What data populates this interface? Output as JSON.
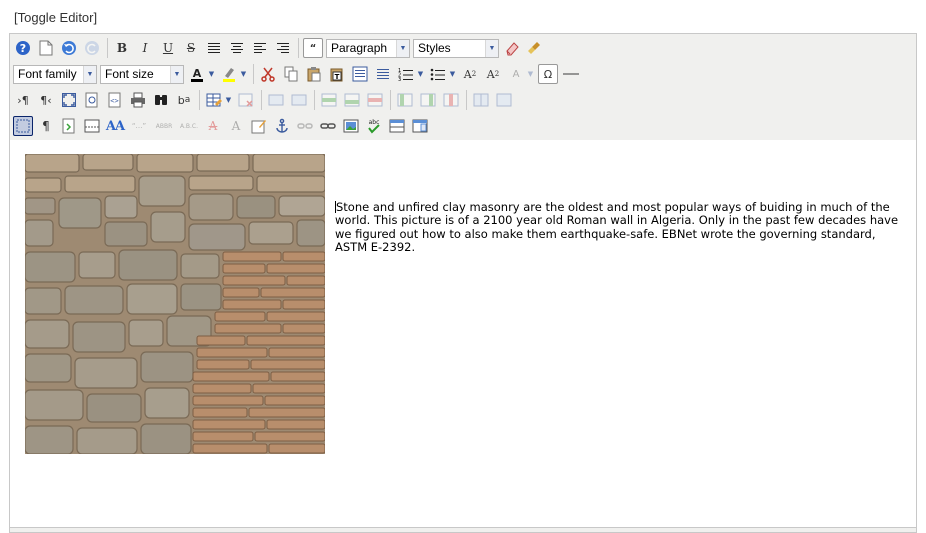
{
  "toggle_label": "[Toggle Editor]",
  "toolbar": {
    "format_select": "Paragraph",
    "styles_select": "Styles",
    "font_family_select": "Font family",
    "font_size_select": "Font size"
  },
  "content": {
    "paragraph": "Stone and unfired clay masonry are the oldest and most popular ways of buiding in much of the world. This picture is of a 2100 year old Roman wall in Algeria. Only in the past few decades have we figured out how to also make them earthquake-safe. EBNet wrote the governing standard, ASTM E-2392."
  },
  "colors": {
    "toolbar_bg": "#f0f0ee",
    "border": "#c8c8c8",
    "icon_blue": "#3b5b9e"
  }
}
